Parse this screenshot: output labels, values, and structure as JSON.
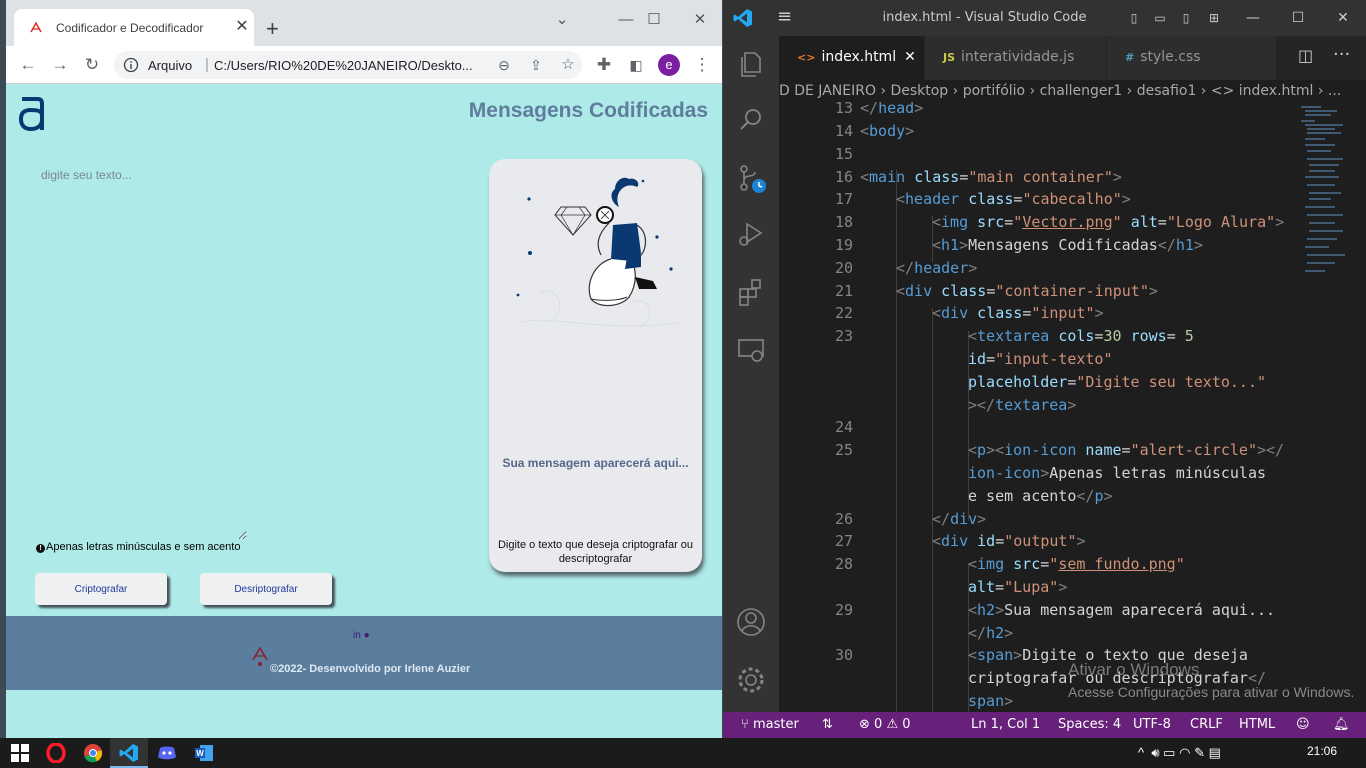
{
  "browser": {
    "tab_title": "Codificador e Decodificador",
    "omnibox_scheme": "Arquivo",
    "omnibox_url": "C:/Users/RIO%20DE%20JANEIRO/Deskto...",
    "profile_initial": "e"
  },
  "page": {
    "title": "Mensagens Codificadas",
    "textarea_placeholder": "digite seu texto...",
    "alert_text": "Apenas letras minúsculas e sem acento",
    "encrypt_button": "Criptografar",
    "decrypt_button": "Desriptografar",
    "output_title": "Sua mensagem aparecerá aqui...",
    "output_hint": "Digite o texto que deseja criptografar ou descriptografar",
    "footer_text": "©2022- Desenvolvido por Irlene Auzier",
    "colors": {
      "background": "#aeeae8",
      "title": "#5f7d9c",
      "footer": "#5b7d9e"
    }
  },
  "vscode": {
    "window_title": "index.html - Visual Studio Code",
    "tabs": [
      {
        "icon": "<>",
        "label": "index.html",
        "active": true
      },
      {
        "icon": "JS",
        "label": "interatividade.js",
        "active": false
      },
      {
        "icon": "#",
        "label": "style.css",
        "active": false
      }
    ],
    "breadcrumb": "D DE JANEIRO  ›  Desktop  ›  portifólio  ›  challenger1  ›  desafio1  ›  <>  index.html  ›  ...",
    "line_numbers": [
      "13",
      "14",
      "15",
      "16",
      "17",
      "18",
      "19",
      "20",
      "21",
      "22",
      "23",
      "24",
      "25",
      "26",
      "27",
      "28",
      "29",
      "30"
    ],
    "watermark_title": "Ativar o Windows",
    "watermark_text": "Acesse Configurações para ativar o Windows.",
    "status": {
      "branch": "master",
      "errors": "0",
      "warnings": "0",
      "position": "Ln 1, Col 1",
      "spaces": "Spaces: 4",
      "encoding": "UTF-8",
      "eol": "CRLF",
      "language": "HTML"
    },
    "accent": "#68217a"
  },
  "taskbar": {
    "time": "21:06"
  }
}
